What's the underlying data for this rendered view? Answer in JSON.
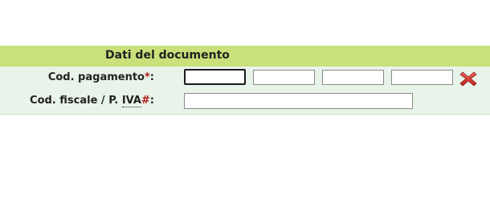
{
  "section": {
    "title": "Dati del documento"
  },
  "fields": {
    "payment_code": {
      "label": "Cod. pagamento",
      "marker": "*",
      "colon": ":",
      "values": [
        "",
        "",
        "",
        ""
      ]
    },
    "tax_code": {
      "label_prefix": "Cod. fiscale / P. ",
      "label_abbr": "IVA",
      "marker": "#",
      "colon": ":",
      "value": ""
    }
  },
  "colors": {
    "header_bg": "#c9e17a",
    "body_bg": "#e8f3ea",
    "required_marker": "#b31b1b",
    "clear_icon": "#d9302c"
  },
  "icons": {
    "clear": "red-x-icon"
  }
}
